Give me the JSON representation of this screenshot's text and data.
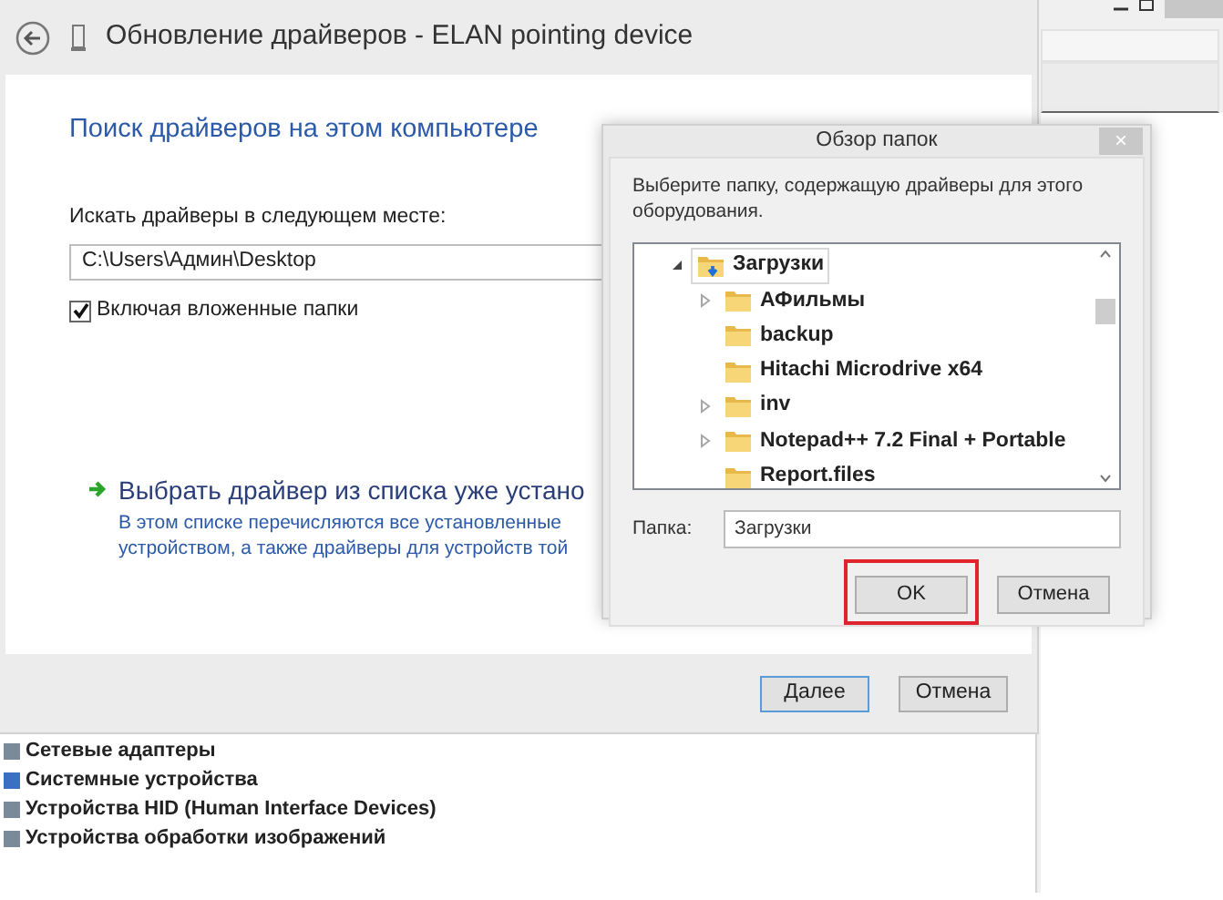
{
  "background_window": {
    "devices": [
      "Сетевые адаптеры",
      "Системные устройства",
      "Устройства HID (Human Interface Devices)",
      "Устройства обработки изображений"
    ]
  },
  "wizard": {
    "title": "Обновление драйверов - ELAN pointing device",
    "heading": "Поиск драйверов на этом компьютере",
    "location_label": "Искать драйверы в следующем месте:",
    "location_value": "C:\\Users\\Админ\\Desktop",
    "include_subfolders": {
      "label": "Включая вложенные папки",
      "checked": true
    },
    "option": {
      "title": "Выбрать драйвер из списка уже устано",
      "description": [
        "В этом списке перечисляются все установленные",
        "устройством, а также драйверы для устройств той"
      ]
    },
    "buttons": [
      {
        "label": "Далее",
        "default": true
      },
      {
        "label": "Отмена",
        "default": false
      }
    ]
  },
  "browse_dialog": {
    "title": "Обзор папок",
    "close": "×",
    "prompt": "Выберите папку, содержащую драйверы для этого оборудования.",
    "tree": [
      {
        "label": "Загрузки",
        "selected": true,
        "expanded": true,
        "children": [
          {
            "label": "АФильмы",
            "selected": false,
            "kind": "expandable"
          },
          {
            "label": "backup",
            "selected": false,
            "kind": "leaf"
          },
          {
            "label": "Hitachi Microdrive x64",
            "selected": false,
            "kind": "leaf"
          },
          {
            "label": "inv",
            "selected": false,
            "kind": "expandable"
          },
          {
            "label": "Notepad++ 7.2 Final + Portable",
            "selected": false,
            "kind": "expandable"
          },
          {
            "label": "Report.files",
            "selected": false,
            "kind": "leaf"
          }
        ]
      }
    ],
    "folder_label": "Папка:",
    "folder_value": "Загрузки",
    "buttons": [
      {
        "label": "OK",
        "highlighted": true
      },
      {
        "label": "Отмена",
        "highlighted": false
      }
    ]
  }
}
